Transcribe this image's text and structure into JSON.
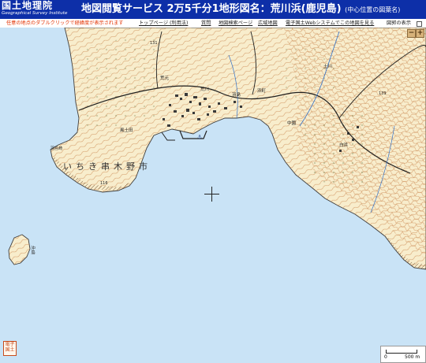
{
  "header": {
    "logo_jp": "国土地理院",
    "logo_en": "Geographical Survey Institute",
    "title": "地図閲覧サービス 2万5千分1地形図名：荒川浜(鹿児島)",
    "title_sub": "(中心位置の図葉名)"
  },
  "nav": {
    "notice": "任意の地点のダブルクリックで経緯度が表示されます",
    "links": [
      "トップページ (利用法)",
      "質問",
      "地図検索ページ",
      "広域地図",
      "電子国土Webシステムでこの地図を見る"
    ],
    "legend_label": "図郭の表示"
  },
  "map": {
    "sea_color": "#c9e3f6",
    "land_color": "#f8edcc",
    "contour_color": "#c9864f",
    "labels": {
      "city": "いちき串木野市",
      "island": "沖島",
      "cape": "羽島崎",
      "place1": "荒元",
      "place2": "羽島",
      "place3": "白浜",
      "place4": "土川",
      "place5": "中園",
      "place6": "荒川",
      "place7": "浜町",
      "place8": "風土田",
      "height1": "116",
      "height2": "139",
      "height3": "131"
    }
  },
  "zoom": {
    "minus": "−",
    "plus": "+"
  },
  "scale": {
    "zero": "0",
    "max": "500 m"
  },
  "stamp": "電子国土"
}
